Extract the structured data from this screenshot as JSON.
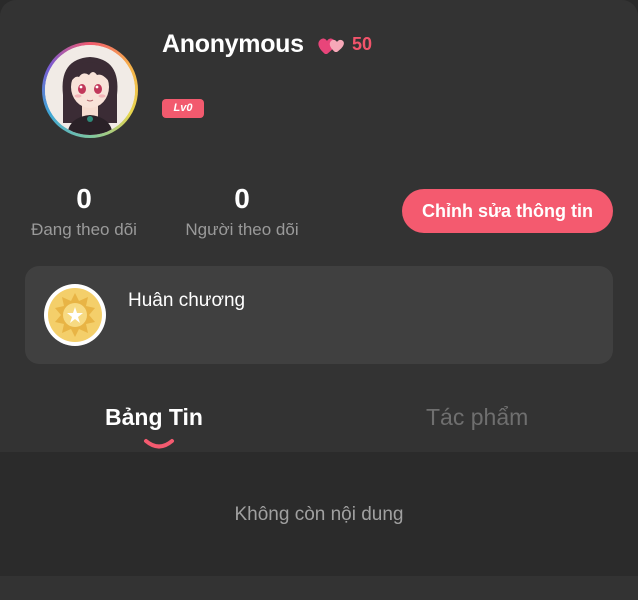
{
  "profile": {
    "username": "Anonymous",
    "heart_count": "50",
    "level": "Lv0"
  },
  "stats": {
    "following_count": "0",
    "following_label": "Đang theo dõi",
    "followers_count": "0",
    "followers_label": "Người theo dõi"
  },
  "actions": {
    "edit_profile_label": "Chỉnh sửa thông tin"
  },
  "medal": {
    "title": "Huân chương"
  },
  "tabs": [
    {
      "label": "Bảng Tin",
      "active": true
    },
    {
      "label": "Tác phẩm",
      "active": false
    }
  ],
  "feed": {
    "empty_text": "Không còn nội dung"
  },
  "colors": {
    "accent": "#f45a6f",
    "background": "#333333",
    "card": "#404040",
    "muted_text": "#9a9a9a"
  },
  "icons": {
    "heart": "double-heart-icon",
    "medal": "medal-icon"
  }
}
